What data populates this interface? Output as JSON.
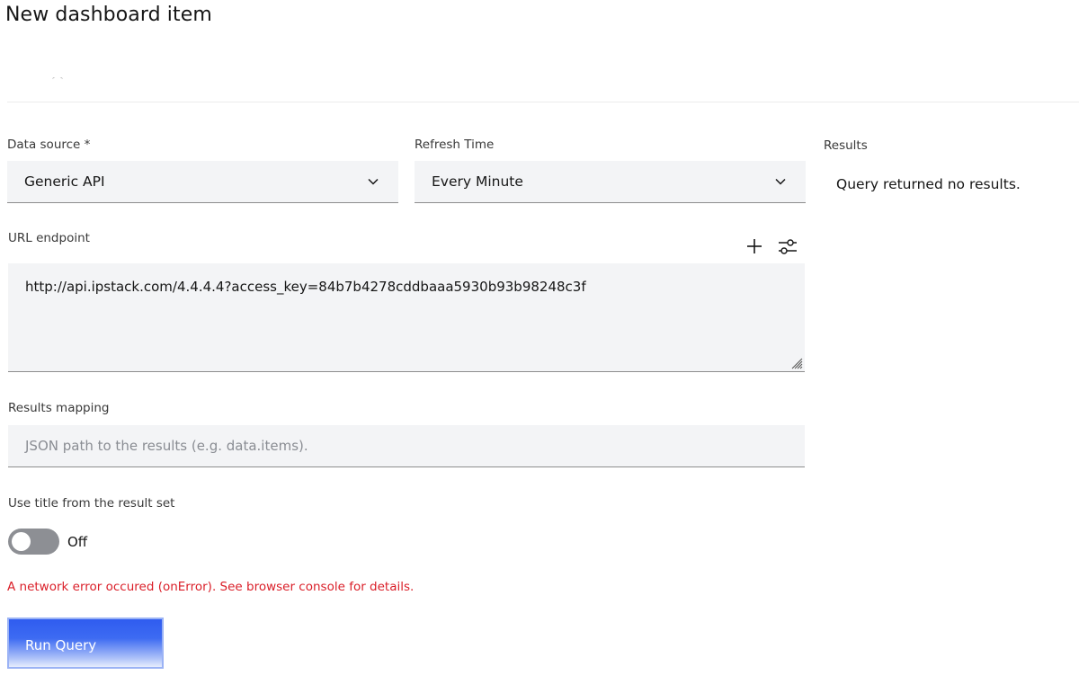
{
  "page": {
    "title": "New dashboard item"
  },
  "data_source": {
    "label": "Data source *",
    "value": "Generic API"
  },
  "refresh_time": {
    "label": "Refresh Time",
    "value": "Every Minute"
  },
  "results": {
    "label": "Results",
    "message": "Query returned no results."
  },
  "url_endpoint": {
    "label": "URL endpoint",
    "value": "http://api.ipstack.com/4.4.4.4?access_key=84b7b4278cddbaaa5930b93b98248c3f",
    "add_icon": "plus-icon",
    "settings_icon": "sliders-icon"
  },
  "results_mapping": {
    "label": "Results mapping",
    "placeholder": "JSON path to the results (e.g. data.items)."
  },
  "use_title": {
    "label": "Use title from the result set",
    "state": "Off",
    "enabled": false
  },
  "error": {
    "message": "A network error occured (onError). See browser console for details.",
    "color": "#da1e28"
  },
  "actions": {
    "run_query_label": "Run Query"
  },
  "colors": {
    "field_bg": "#f3f4f6",
    "accent": "#2f5cf0",
    "toggle_off": "#8d8f94"
  }
}
